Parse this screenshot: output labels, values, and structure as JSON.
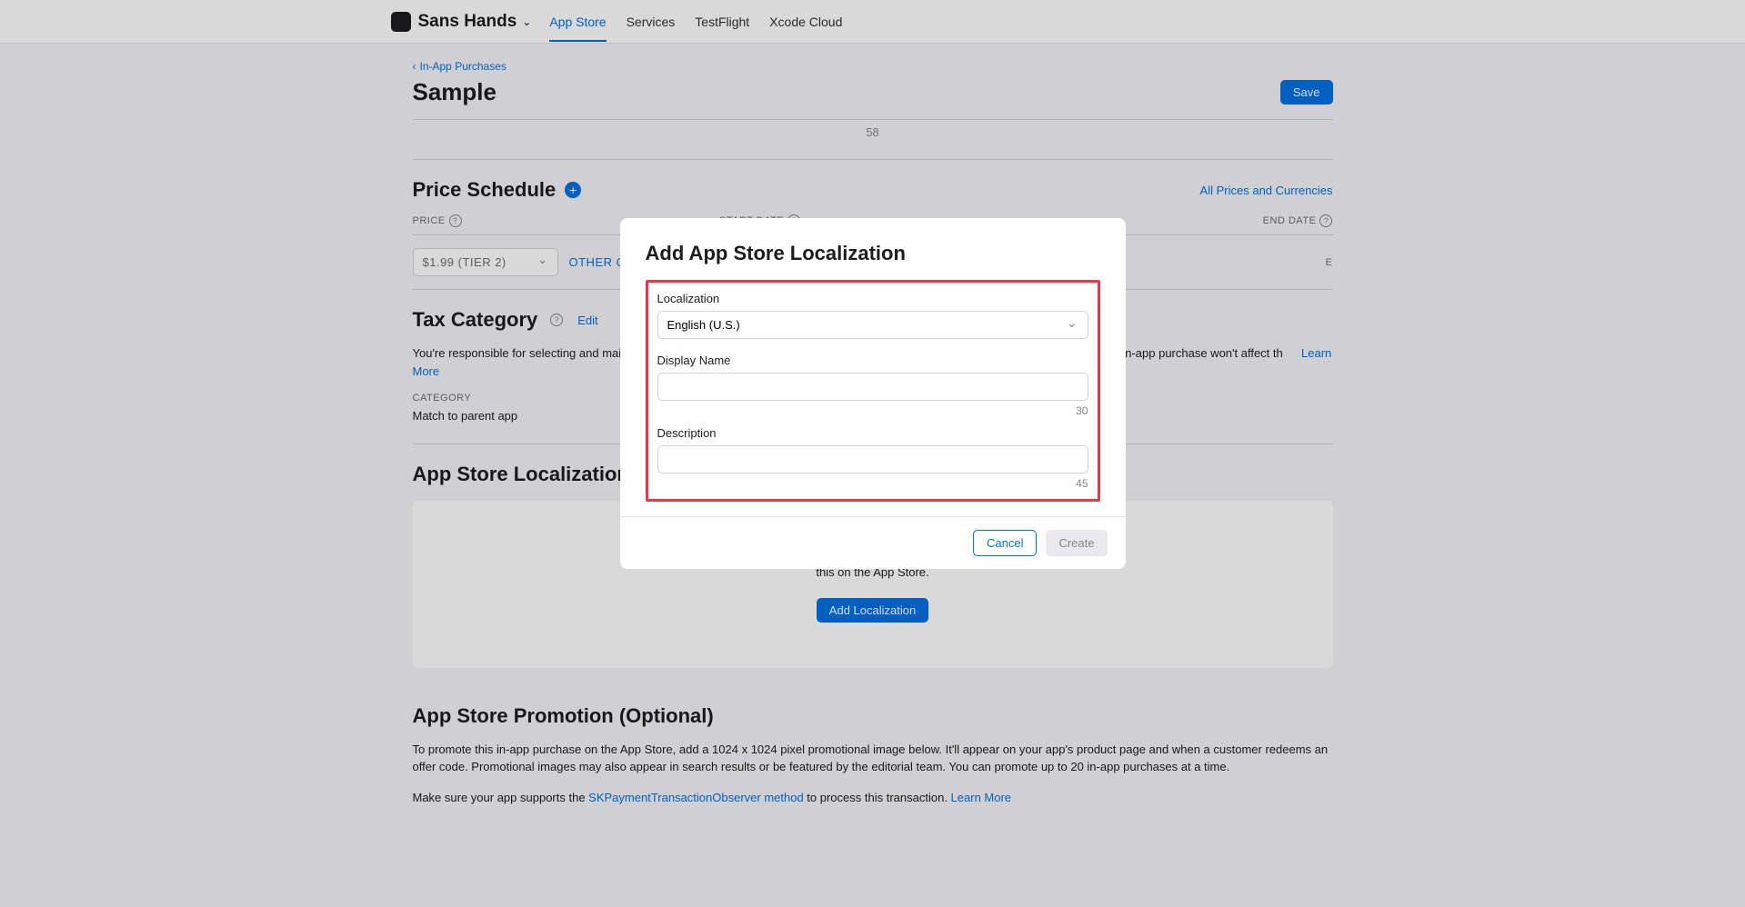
{
  "header": {
    "app_name": "Sans Hands",
    "tabs": [
      "App Store",
      "Services",
      "TestFlight",
      "Xcode Cloud"
    ],
    "active_tab": 0
  },
  "breadcrumb": "In-App Purchases",
  "page_title": "Sample",
  "save_button": "Save",
  "counter_58": "58",
  "price_schedule": {
    "title": "Price Schedule",
    "all_link": "All Prices and Currencies",
    "col_price": "PRICE",
    "col_start": "START DATE",
    "col_end": "END DATE",
    "price_value": "$1.99 (Tier 2)",
    "other_link": "Other Cur",
    "end_value": "e"
  },
  "tax": {
    "title": "Tax Category",
    "edit": "Edit",
    "body_start": "You're responsible for selecting and maintaining",
    "body_end": "u choose a different one. Changing the tax category for this in-app purchase won't affect th",
    "learn_more": "Learn More",
    "category_label": "Category",
    "category_value": "Match to parent app"
  },
  "localization": {
    "title": "App Store Localization",
    "description": "Provide a display name and description for your in-app purchase, and we'll show this on the App Store.",
    "button": "Add Localization"
  },
  "promotion": {
    "title": "App Store Promotion (Optional)",
    "body": "To promote this in-app purchase on the App Store, add a 1024 x 1024 pixel promotional image below. It'll appear on your app's product page and when a customer redeems an offer code. Promotional images may also appear in search results or be featured by the editorial team. You can promote up to 20 in-app purchases at a time.",
    "line2_start": "Make sure your app supports the ",
    "line2_link": "SKPaymentTransactionObserver method",
    "line2_mid": " to process this transaction. ",
    "learn_more": "Learn More"
  },
  "modal": {
    "title": "Add App Store Localization",
    "loc_label": "Localization",
    "loc_value": "English (U.S.)",
    "display_label": "Display Name",
    "display_count": "30",
    "desc_label": "Description",
    "desc_count": "45",
    "cancel": "Cancel",
    "create": "Create"
  }
}
